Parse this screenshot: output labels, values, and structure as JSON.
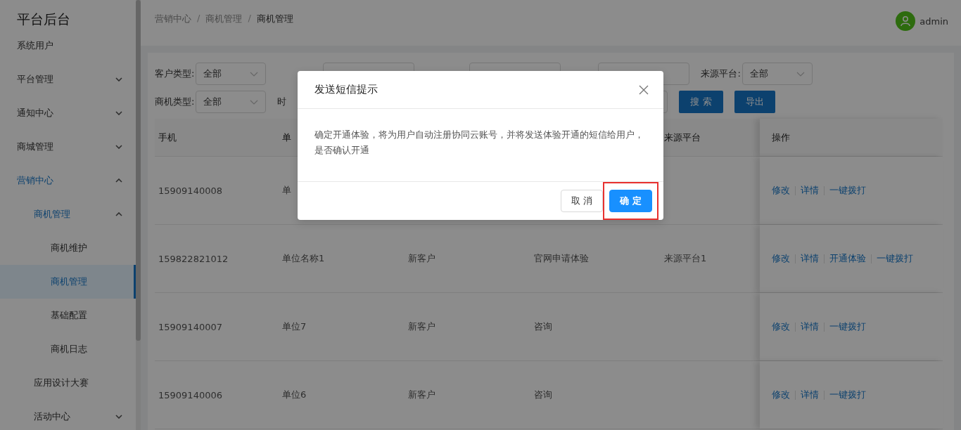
{
  "sidebar": {
    "title": "平台后台",
    "items": [
      {
        "label": "系统用户",
        "selected": false
      },
      {
        "label": "平台管理",
        "selected": false,
        "expanded": false
      },
      {
        "label": "通知中心",
        "selected": false,
        "expanded": false
      },
      {
        "label": "商城管理",
        "selected": false,
        "expanded": false
      },
      {
        "label": "营销中心",
        "selected": false,
        "expanded": true,
        "children": [
          {
            "label": "商机管理",
            "selected": false,
            "expanded": true,
            "children": [
              {
                "label": "商机维护",
                "selected": false
              },
              {
                "label": "商机管理",
                "selected": true
              },
              {
                "label": "基础配置",
                "selected": false
              },
              {
                "label": "商机日志",
                "selected": false
              }
            ]
          },
          {
            "label": "应用设计大赛",
            "selected": false
          },
          {
            "label": "活动中心",
            "selected": false,
            "expanded": false
          }
        ]
      }
    ]
  },
  "header": {
    "breadcrumb": [
      "营销中心",
      "商机管理",
      "商机管理"
    ],
    "separator": "/",
    "user": "admin"
  },
  "filters": {
    "row_1": [
      {
        "kind": "select",
        "label": "客户类型:",
        "value": "全部"
      },
      {
        "kind": "input"
      },
      {
        "kind": "input"
      },
      {
        "kind": "input"
      },
      {
        "kind": "select",
        "label": "来源平台:",
        "value": "全部"
      }
    ],
    "row_2": [
      {
        "kind": "select",
        "label": "商机类型:",
        "value": "全部"
      },
      {
        "kind": "range",
        "label": "时"
      }
    ],
    "buttons": [
      "搜 索",
      "导出"
    ]
  },
  "table": {
    "columns": [
      "手机",
      "单",
      "",
      "",
      "来源平台",
      "操作"
    ],
    "rows": [
      {
        "cells": [
          "15909140008",
          "单",
          "",
          "",
          ""
        ],
        "actions": [
          "修改",
          "详情",
          "一键拨打"
        ]
      },
      {
        "cells": [
          "159822821012",
          "单位名称1",
          "新客户",
          "官网申请体验",
          "来源平台1"
        ],
        "actions": [
          "修改",
          "详情",
          "开通体验",
          "一键拨打"
        ]
      },
      {
        "cells": [
          "15909140007",
          "单位7",
          "新客户",
          "咨询",
          ""
        ],
        "actions": [
          "修改",
          "详情",
          "一键拨打"
        ]
      },
      {
        "cells": [
          "15909140006",
          "单位6",
          "新客户",
          "咨询",
          ""
        ],
        "actions": [
          "修改",
          "详情",
          "一键拨打"
        ]
      }
    ]
  },
  "dialog": {
    "title": "发送短信提示",
    "message": "确定开通体验，将为用户自动注册协同云账号，并将发送体验开通的短信给用户，是否确认开通",
    "buttons": [
      {
        "label": "取 消",
        "kind": "default",
        "highlighted": false
      },
      {
        "label": "确 定",
        "kind": "primary",
        "highlighted": true
      }
    ]
  }
}
